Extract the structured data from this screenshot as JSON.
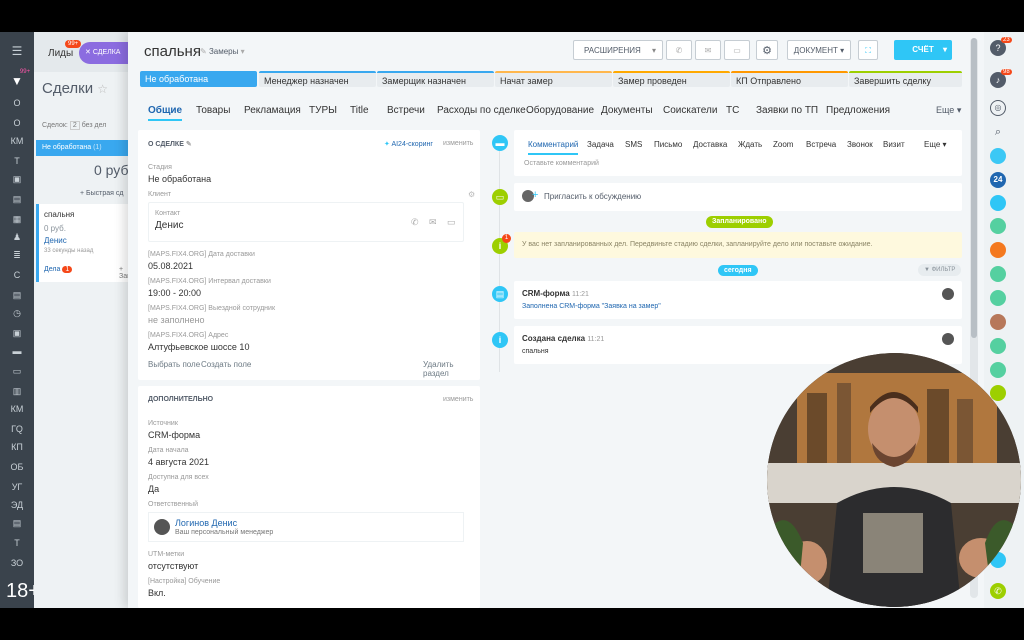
{
  "rail": {
    "items": [
      "О",
      "О",
      "КМ",
      "Т",
      "Е",
      "С",
      "КМ",
      "ГQ",
      "КП",
      "ОБ",
      "УГ",
      "ЭД",
      "Т",
      "ЗО"
    ],
    "badge_top": "99+"
  },
  "bg": {
    "leads": "Лиды",
    "leads_badge": "99+",
    "deal_tab": "СДЕЛКА",
    "title": "Сделки",
    "deals_label": "Сделок:",
    "deals_count": "2",
    "deals_suffix": "без дел",
    "stage": "Не обработана",
    "stage_count": "(1)",
    "sum": "0 руб.",
    "quick": "+ Быстрая сд",
    "card_title": "спальня",
    "card_sum": "0 руб.",
    "card_contact": "Денис",
    "card_time": "33 секунды назад",
    "card_tasks": "Дела",
    "card_tasks_count": "1",
    "card_add": "+ Зап"
  },
  "age": "18+",
  "header": {
    "title": "спальня",
    "category": "Замеры",
    "btn_ext": "РАСШИРЕНИЯ",
    "btn_doc": "ДОКУМЕНТ",
    "btn_invoice": "СЧЁТ"
  },
  "stages": [
    "Не обработана",
    "Менеджер назначен",
    "Замерщик назначен",
    "Начат замер",
    "Замер проведен",
    "КП Отправлено",
    "Завершить сделку"
  ],
  "tabs": [
    "Общие",
    "Товары",
    "Рекламация",
    "ТУРЫ",
    "Title",
    "Встречи",
    "Расходы по сделке",
    "Оборудование",
    "Документы",
    "Соискатели",
    "ТС",
    "Заявки по ТП",
    "Предложения",
    "Еще"
  ],
  "about": {
    "head": "О СДЕЛКЕ",
    "scoring": "AI24-скоринг",
    "edit": "изменить",
    "stage_lab": "Стадия",
    "stage_val": "Не обработана",
    "client_lab": "Клиент",
    "contact_lab": "Контакт",
    "contact_val": "Денис",
    "date_lab": "[MAPS.FIX4.ORG] Дата доставки",
    "date_val": "05.08.2021",
    "interval_lab": "[MAPS.FIX4.ORG] Интервал доставки",
    "interval_val": "19:00 - 20:00",
    "emp_lab": "[MAPS.FIX4.ORG] Выездной сотрудник",
    "emp_val": "не заполнено",
    "addr_lab": "[MAPS.FIX4.ORG] Адрес",
    "addr_val": "Алтуфьевское шоссе 10",
    "choose": "Выбрать поле",
    "create": "Создать поле",
    "delete": "Удалить раздел"
  },
  "extra": {
    "head": "ДОПОЛНИТЕЛЬНО",
    "edit": "изменить",
    "src_lab": "Источник",
    "src_val": "CRM-форма",
    "start_lab": "Дата начала",
    "start_val": "4 августа 2021",
    "avail_lab": "Доступна для всех",
    "avail_val": "Да",
    "resp_lab": "Ответственный",
    "resp_name": "Логинов Денис",
    "resp_role": "Ваш персональный менеджер",
    "utm_lab": "UTM-метки",
    "utm_val": "отсутствуют",
    "train_lab": "[Настройка] Обучение",
    "train_val": "Вкл."
  },
  "activity": {
    "tabs": [
      "Комментарий",
      "Задача",
      "SMS",
      "Письмо",
      "Доставка",
      "Ждать",
      "Zoom",
      "Встреча",
      "Звонок",
      "Визит",
      "Еще"
    ],
    "placeholder": "Оставьте комментарий",
    "invite": "Пригласить к обсуждению",
    "planned": "Запланировано",
    "warn": "У вас нет запланированных дел. Передвиньте стадию сделки, запланируйте дело или поставьте ожидание.",
    "today": "сегодня",
    "filter": "ФИЛЬТР",
    "ev1_title": "CRM-форма",
    "ev1_time": "11:21",
    "ev1_text": "Заполнена CRM-форма \"Заявка на замер\"",
    "ev2_title": "Создана сделка",
    "ev2_time": "11:21",
    "ev2_text": "спальня"
  },
  "right": {
    "badge1": "23",
    "badge2": "98",
    "num": "24"
  },
  "colors": {
    "accent": "#2fc6f6",
    "stage_new": "#39a8ef",
    "green": "#9dcf00",
    "link": "#2067b0"
  }
}
